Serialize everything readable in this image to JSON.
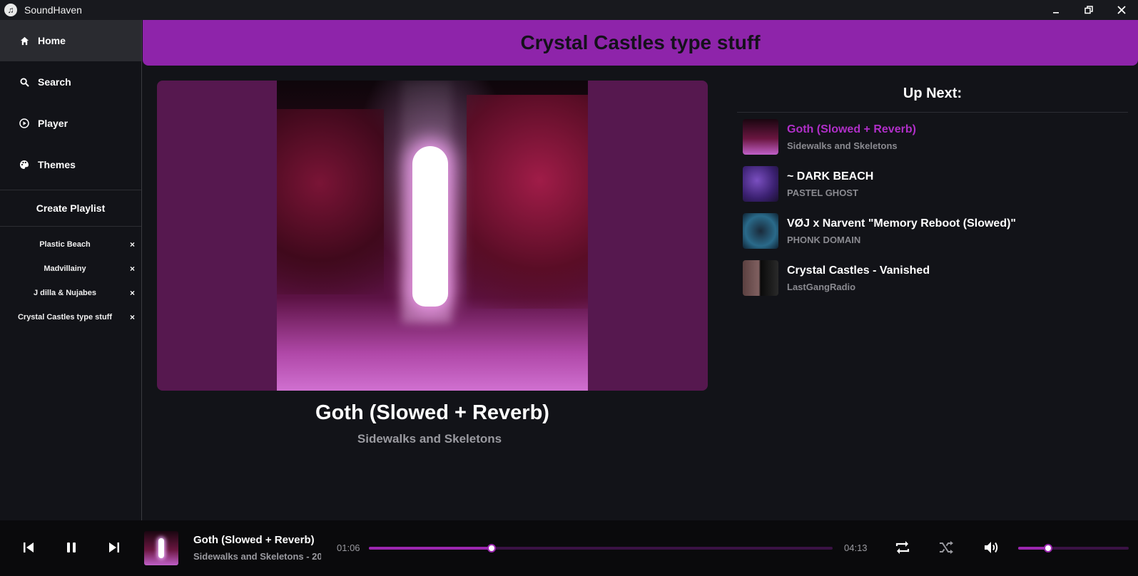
{
  "window": {
    "title": "SoundHaven",
    "minimize_label": "–",
    "restore_label": "⧉",
    "close_label": "✕"
  },
  "sidebar": {
    "nav": [
      {
        "label": "Home",
        "icon": "home-icon",
        "active": true
      },
      {
        "label": "Search",
        "icon": "search-icon"
      },
      {
        "label": "Player",
        "icon": "play-circle-icon"
      },
      {
        "label": "Themes",
        "icon": "palette-icon"
      }
    ],
    "create_playlist": "Create Playlist",
    "playlists": [
      {
        "name": "Plastic Beach",
        "remove": "×"
      },
      {
        "name": "Madvillainy",
        "remove": "×"
      },
      {
        "name": "J dilla & Nujabes",
        "remove": "×"
      },
      {
        "name": "Crystal Castles type stuff",
        "remove": "×"
      }
    ]
  },
  "header": {
    "title": "Crystal Castles type stuff"
  },
  "now_playing": {
    "title": "Goth (Slowed + Reverb)",
    "artist": "Sidewalks and Skeletons"
  },
  "up_next": {
    "heading": "Up Next:",
    "items": [
      {
        "title": "Goth (Slowed + Reverb)",
        "artist": "Sidewalks and Skeletons",
        "playing": true
      },
      {
        "title": "~ DARK BEACH",
        "artist": "PASTEL GHOST"
      },
      {
        "title": "VØJ x Narvent \"Memory Reboot (Slowed)\"",
        "artist": "PHONK DOMAIN"
      },
      {
        "title": "Crystal Castles - Vanished",
        "artist": "LastGangRadio"
      }
    ]
  },
  "player": {
    "title": "Goth (Slowed + Reverb)",
    "artist": "Sidewalks and Skeletons - 20",
    "elapsed": "01:06",
    "duration": "04:13",
    "progress": 0.265,
    "volume": 0.27,
    "accent": "#9c27b0"
  },
  "colors": {
    "accent": "#8e24aa",
    "playing_text": "#b02fc8",
    "background": "#121318"
  }
}
